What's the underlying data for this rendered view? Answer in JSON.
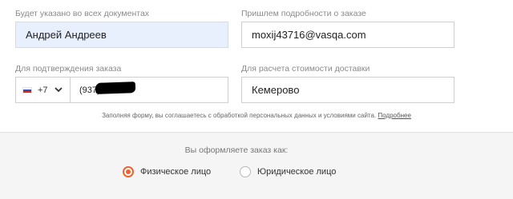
{
  "fields": {
    "name": {
      "label": "Будет указано во всех документах",
      "value": "Андрей Андреев"
    },
    "email": {
      "label": "Пришлем подробности о заказе",
      "value": "moxij43716@vasqa.com"
    },
    "phone": {
      "label": "Для подтверждения заказа",
      "country_code": "+7",
      "value": "(937)"
    },
    "city": {
      "label": "Для расчета стоимости доставки",
      "value": "Кемерово"
    }
  },
  "consent": {
    "text": "Заполняя форму, вы соглашаетесь с обработкой персональных данных и условиями сайта.",
    "link_label": "Подробнее"
  },
  "order_type": {
    "question": "Вы оформляете заказ как:",
    "options": [
      {
        "label": "Физическое лицо",
        "selected": true
      },
      {
        "label": "Юридическое лицо",
        "selected": false
      }
    ]
  },
  "colors": {
    "accent": "#f0612f",
    "autofill": "#e8f0fe"
  }
}
